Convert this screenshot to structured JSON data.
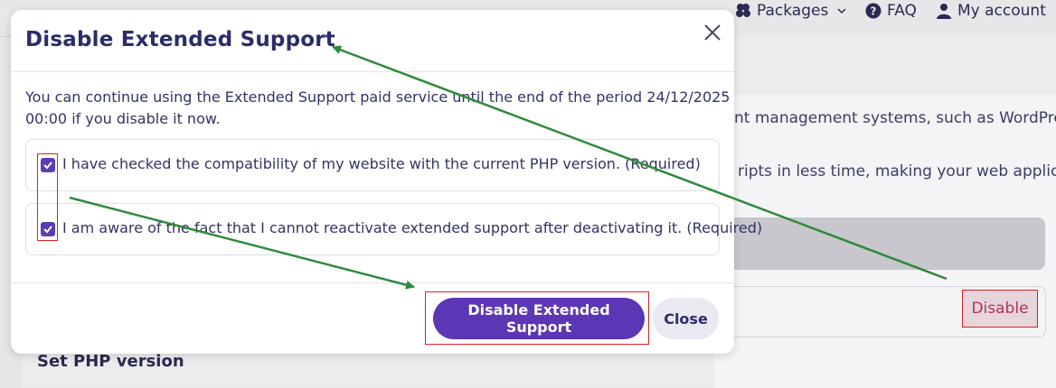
{
  "topbar": {
    "packages_label": "Packages",
    "faq_label": "FAQ",
    "account_label": "My account"
  },
  "background": {
    "line1": "nt management systems, such as WordPress",
    "line2": "ripts in less time, making your web application",
    "disable_label": "Disable",
    "set_php_label": "Set PHP version"
  },
  "modal": {
    "title": "Disable Extended Support",
    "description": "You can continue using the Extended Support paid service until the end of the period 24/12/2025 00:00 if you disable it now.",
    "checkboxes": [
      {
        "label": "I have checked the compatibility of my website with the current PHP version. (Required)",
        "checked": true
      },
      {
        "label": "I am aware of the fact that I cannot reactivate extended support after deactivating it. (Required)",
        "checked": true
      }
    ],
    "primary_button": "Disable Extended Support",
    "close_button": "Close"
  },
  "colors": {
    "accent": "#5b36b5",
    "highlight": "#e02020",
    "arrow": "#2f8a3c",
    "title": "#2c2c6a"
  },
  "icons": [
    "packages-icon",
    "chevron-down-icon",
    "faq-icon",
    "user-icon",
    "close-icon",
    "checkmark-icon"
  ]
}
